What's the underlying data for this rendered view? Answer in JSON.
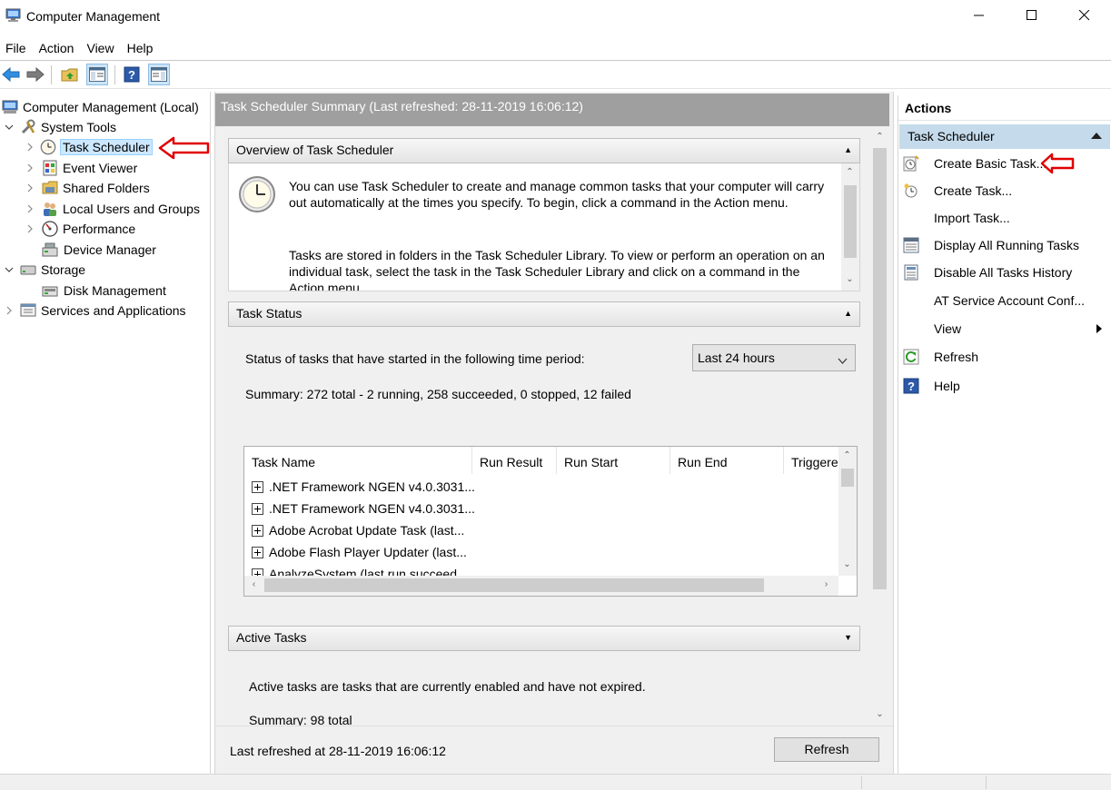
{
  "window": {
    "title": "Computer Management"
  },
  "menu": [
    "File",
    "Action",
    "View",
    "Help"
  ],
  "toolbar": {
    "icons": [
      "back-arrow-icon",
      "forward-arrow-icon",
      "up-folder-icon",
      "show-hide-tree-icon",
      "help-icon",
      "show-hide-action-pane-icon"
    ]
  },
  "tree": {
    "root": "Computer Management (Local)",
    "system_tools": "System Tools",
    "task_scheduler": "Task Scheduler",
    "event_viewer": "Event Viewer",
    "shared_folders": "Shared Folders",
    "local_users": "Local Users and Groups",
    "performance": "Performance",
    "device_manager": "Device Manager",
    "storage": "Storage",
    "disk_management": "Disk Management",
    "services": "Services and Applications"
  },
  "center": {
    "header": "Task Scheduler Summary (Last refreshed: 28-11-2019 16:06:12)",
    "overview": {
      "title": "Overview of Task Scheduler",
      "p1": "You can use Task Scheduler to create and manage common tasks that your computer will carry out automatically at the times you specify. To begin, click a command in the Action menu.",
      "p2": "Tasks are stored in folders in the Task Scheduler Library. To view or perform an operation on an individual task, select the task in the Task Scheduler Library and click on a command in the Action menu."
    },
    "status": {
      "title": "Task Status",
      "period_label": "Status of tasks that have started in the following time period:",
      "period_value": "Last 24 hours",
      "summary": "Summary: 272 total - 2 running, 258 succeeded, 0 stopped, 12 failed",
      "columns": [
        "Task Name",
        "Run Result",
        "Run Start",
        "Run End",
        "Triggered"
      ],
      "rows": [
        ".NET Framework NGEN v4.0.3031...",
        ".NET Framework NGEN v4.0.3031...",
        "Adobe Acrobat Update Task (last...",
        "Adobe Flash Player Updater (last...",
        "AnalyzeSystem (last run succeed..."
      ]
    },
    "active": {
      "title": "Active Tasks",
      "description": "Active tasks are tasks that are currently enabled and have not expired.",
      "summary": "Summary: 98 total"
    },
    "footer": {
      "last_refreshed": "Last refreshed at 28-11-2019 16:06:12",
      "refresh_button": "Refresh"
    }
  },
  "actions": {
    "title": "Actions",
    "section": "Task Scheduler",
    "items": [
      {
        "label": "Create Basic Task...",
        "icon": "create-basic-task-icon"
      },
      {
        "label": "Create Task...",
        "icon": "create-task-icon"
      },
      {
        "label": "Import Task...",
        "icon": ""
      },
      {
        "label": "Display All Running Tasks",
        "icon": "running-tasks-icon"
      },
      {
        "label": "Disable All Tasks History",
        "icon": "tasks-history-icon"
      },
      {
        "label": "AT Service Account Conf...",
        "icon": ""
      },
      {
        "label": "View",
        "icon": ""
      },
      {
        "label": "Refresh",
        "icon": "refresh-icon"
      },
      {
        "label": "Help",
        "icon": "help-icon"
      }
    ]
  },
  "annotations": {
    "arrow_color": "#e00000"
  }
}
